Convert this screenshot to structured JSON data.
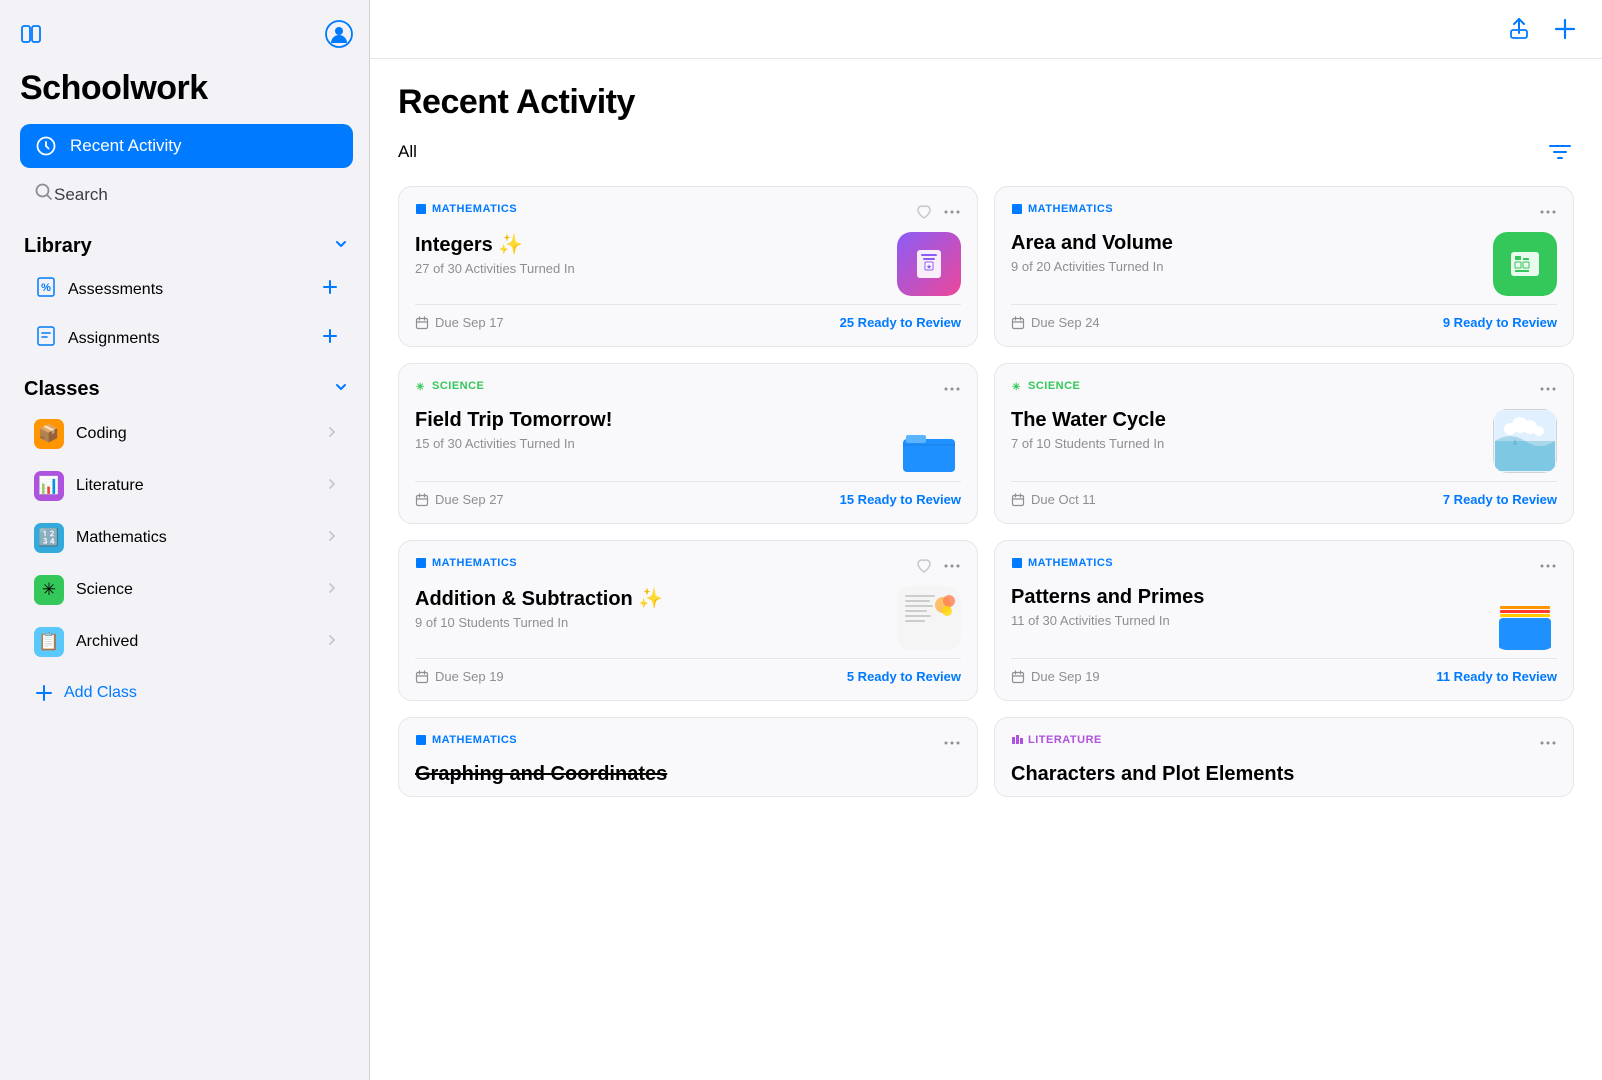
{
  "app": {
    "title": "Schoolwork"
  },
  "sidebar": {
    "title": "Schoolwork",
    "nav": {
      "recent_activity": "Recent Activity",
      "search": "Search"
    },
    "library": {
      "label": "Library",
      "items": [
        {
          "id": "assessments",
          "label": "Assessments",
          "icon": "percent"
        },
        {
          "id": "assignments",
          "label": "Assignments",
          "icon": "doc"
        }
      ]
    },
    "classes": {
      "label": "Classes",
      "items": [
        {
          "id": "coding",
          "label": "Coding",
          "color": "coding"
        },
        {
          "id": "literature",
          "label": "Literature",
          "color": "literature"
        },
        {
          "id": "mathematics",
          "label": "Mathematics",
          "color": "mathematics"
        },
        {
          "id": "science",
          "label": "Science",
          "color": "science"
        },
        {
          "id": "archived",
          "label": "Archived",
          "color": "archived"
        }
      ]
    },
    "add_class": "Add Class"
  },
  "main": {
    "page_title": "Recent Activity",
    "filter_label": "All",
    "cards": [
      {
        "id": "integers",
        "category": "MATHEMATICS",
        "category_type": "mathematics",
        "title": "Integers ✨",
        "subtitle": "27 of 30 Activities Turned In",
        "app_icon": "keynote",
        "due": "Due Sep 17",
        "ready": "25 Ready to Review"
      },
      {
        "id": "area-volume",
        "category": "MATHEMATICS",
        "category_type": "mathematics",
        "title": "Area and Volume",
        "subtitle": "9 of 20 Activities Turned In",
        "app_icon": "numbers",
        "due": "Due Sep 24",
        "ready": "9 Ready to Review"
      },
      {
        "id": "field-trip",
        "category": "SCIENCE",
        "category_type": "science",
        "title": "Field Trip Tomorrow!",
        "subtitle": "15 of 30 Activities Turned In",
        "app_icon": "folder",
        "due": "Due Sep 27",
        "ready": "15 Ready to Review"
      },
      {
        "id": "water-cycle",
        "category": "SCIENCE",
        "category_type": "science",
        "title": "The Water Cycle",
        "subtitle": "7 of 10 Students Turned In",
        "app_icon": "water",
        "due": "Due Oct 11",
        "ready": "7 Ready to Review"
      },
      {
        "id": "addition-subtraction",
        "category": "MATHEMATICS",
        "category_type": "mathematics",
        "title": "Addition & Subtraction ✨",
        "subtitle": "9 of 10 Students Turned In",
        "app_icon": "doc-math",
        "due": "Due Sep 19",
        "ready": "5 Ready to Review"
      },
      {
        "id": "patterns-primes",
        "category": "MATHEMATICS",
        "category_type": "mathematics",
        "title": "Patterns and Primes",
        "subtitle": "11 of 30 Activities Turned In",
        "app_icon": "folder-yellow",
        "due": "Due Sep 19",
        "ready": "11 Ready to Review"
      },
      {
        "id": "graphing",
        "category": "MATHEMATICS",
        "category_type": "mathematics",
        "title": "Graphing and Coordinates",
        "subtitle": "",
        "app_icon": "none",
        "due": "",
        "ready": "",
        "strikethrough": true
      },
      {
        "id": "characters",
        "category": "LITERATURE",
        "category_type": "literature",
        "title": "Characters and Plot Elements",
        "subtitle": "",
        "app_icon": "none",
        "due": "",
        "ready": ""
      }
    ]
  }
}
